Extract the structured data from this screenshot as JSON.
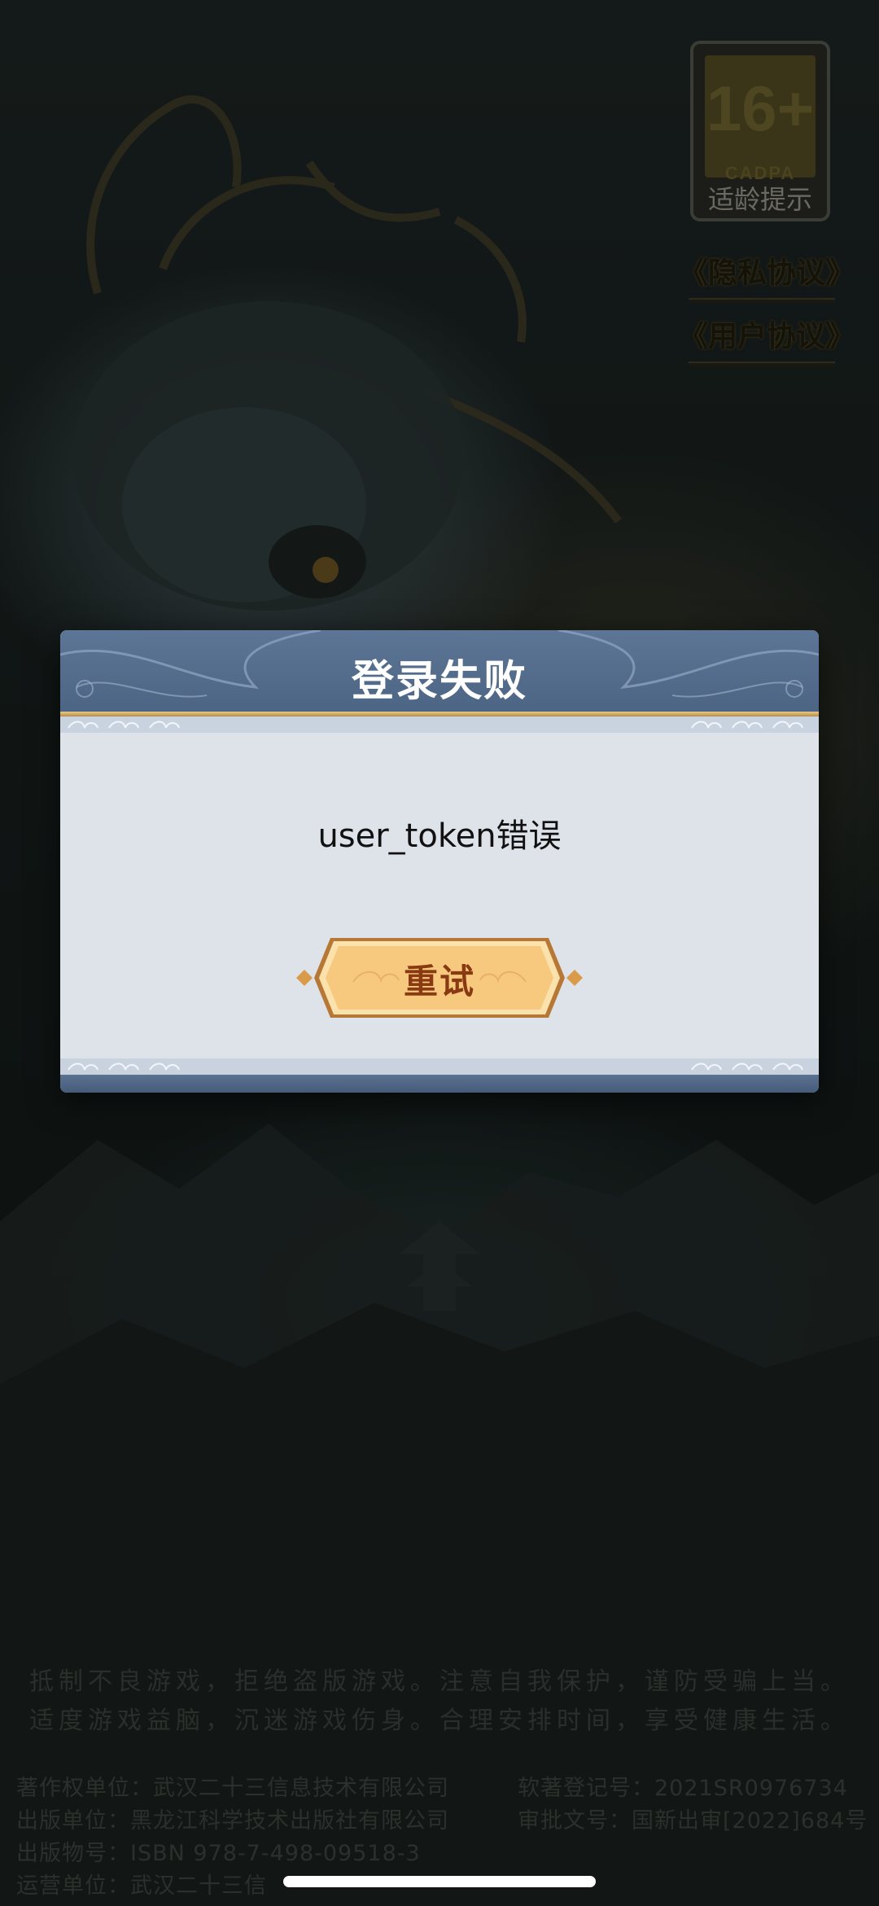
{
  "age_badge": {
    "age": "16+",
    "org": "CADPA",
    "label": "适龄提示"
  },
  "links": {
    "privacy": "《隐私协议》",
    "user": "《用户协议》"
  },
  "dialog": {
    "title": "登录失败",
    "message": "user_token错误",
    "retry_label": "重试"
  },
  "health_notice": {
    "line1": "抵制不良游戏，拒绝盗版游戏。注意自我保护，谨防受骗上当。",
    "line2": "适度游戏益脑，沉迷游戏伤身。合理安排时间，享受健康生活。"
  },
  "publish_info": {
    "copyright_holder": "著作权单位：武汉二十三信息技术有限公司",
    "software_reg": "软著登记号：2021SR0976734",
    "publisher": "出版单位：黑龙江科学技术出版社有限公司",
    "approval": "审批文号：国新出审[2022]684号",
    "isbn": "出版物号：ISBN 978-7-498-09518-3",
    "operator": "运营单位：武汉二十三信"
  },
  "colors": {
    "dialog_header": "#5d7696",
    "dialog_body": "#dee3ea",
    "button_fill": "#f8cf85",
    "button_text": "#8a3a12"
  }
}
